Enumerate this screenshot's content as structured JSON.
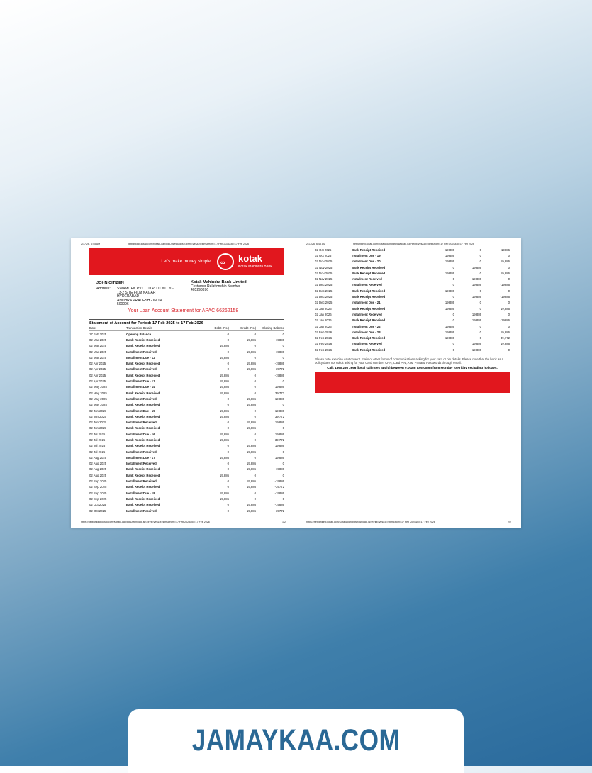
{
  "header": {
    "date": "2/17/26, 6:45 AM",
    "url": "netbanking.kotak.com/KotakLoan/pdfDownload.jsp?print=yes&ct=stmt&from=17 Feb 2025&to=17 Feb 2026"
  },
  "footer": {
    "url": "https://netbanking.kotak.com/KotakLoan/pdfDownload.jsp?print=yes&ct=stmt&from=17 Feb 2025&to=17 Feb 2026",
    "page1": "1/2",
    "page2": "2/2"
  },
  "banner": {
    "tagline": "Let's make money simple",
    "brand": "kotak",
    "brand_sub": "Kotak Mahindra Bank",
    "color": "#e1171e"
  },
  "customer": {
    "name": "JOHN CITIZEN",
    "address_label": "Address:",
    "address_lines": [
      "SWAMITEK PVT LTD PLOT NO 20-",
      "13-2 SITE FILM NAGAR",
      "HYDERABAD",
      "ANDHRA PRADESH - INDIA",
      "500096"
    ]
  },
  "bank": {
    "name": "Kotak Mahindra Bank Limited",
    "crn_label": "Customer Relationship Number",
    "crn": "405298896"
  },
  "statement": {
    "title": "Your Loan Account Statement for APAC 66262158",
    "period_label": "Statement of Account for Period:",
    "period": "17 Feb 2025 to 17 Feb 2026"
  },
  "columns": [
    "Date",
    "Transaction Details",
    "Debit (Rs.)",
    "Credit (Rs.)",
    "Closing Balance"
  ],
  "page1_rows": [
    [
      "17 Feb 2025",
      "Opening Balance",
      "0",
      "0",
      "0"
    ],
    [
      "02 Mar 2025",
      "Bank Receipt Received",
      "0",
      "19,886",
      "-19886"
    ],
    [
      "02 Mar 2025",
      "Bank Receipt Received",
      "19,886",
      "0",
      "0"
    ],
    [
      "02 Mar 2025",
      "Installment Received",
      "0",
      "19,886",
      "-19886"
    ],
    [
      "02 Mar 2025",
      "Installment Due - 12",
      "19,886",
      "0",
      "0"
    ],
    [
      "02 Apr 2025",
      "Bank Receipt Received",
      "0",
      "19,886",
      "-19886"
    ],
    [
      "02 Apr 2025",
      "Installment Received",
      "0",
      "19,886",
      "-39772"
    ],
    [
      "02 Apr 2025",
      "Bank Receipt Received",
      "19,886",
      "0",
      "-19886"
    ],
    [
      "02 Apr 2025",
      "Installment Due - 13",
      "19,886",
      "0",
      "0"
    ],
    [
      "02 May 2025",
      "Installment Due - 14",
      "19,886",
      "0",
      "19,886"
    ],
    [
      "02 May 2025",
      "Bank Receipt Received",
      "19,886",
      "0",
      "39,772"
    ],
    [
      "02 May 2025",
      "Installment Received",
      "0",
      "19,886",
      "19,886"
    ],
    [
      "02 May 2025",
      "Bank Receipt Received",
      "0",
      "19,886",
      "0"
    ],
    [
      "02 Jun 2025",
      "Installment Due - 15",
      "19,886",
      "0",
      "19,886"
    ],
    [
      "02 Jun 2025",
      "Bank Receipt Received",
      "19,886",
      "0",
      "39,772"
    ],
    [
      "02 Jun 2025",
      "Installment Received",
      "0",
      "19,886",
      "19,886"
    ],
    [
      "02 Jun 2025",
      "Bank Receipt Received",
      "0",
      "19,886",
      "0"
    ],
    [
      "02 Jul 2025",
      "Installment Due - 16",
      "19,886",
      "0",
      "19,886"
    ],
    [
      "02 Jul 2025",
      "Bank Receipt Received",
      "19,886",
      "0",
      "39,772"
    ],
    [
      "02 Jul 2025",
      "Bank Receipt Received",
      "0",
      "19,886",
      "19,886"
    ],
    [
      "02 Jul 2025",
      "Installment Received",
      "0",
      "19,886",
      "0"
    ],
    [
      "02 Aug 2025",
      "Installment Due - 17",
      "19,886",
      "0",
      "19,886"
    ],
    [
      "02 Aug 2025",
      "Installment Received",
      "0",
      "19,886",
      "0"
    ],
    [
      "02 Aug 2025",
      "Bank Receipt Received",
      "0",
      "19,886",
      "-19886"
    ],
    [
      "02 Aug 2025",
      "Bank Receipt Received",
      "19,886",
      "0",
      "0"
    ],
    [
      "02 Sep 2025",
      "Installment Received",
      "0",
      "19,886",
      "-19886"
    ],
    [
      "02 Sep 2025",
      "Bank Receipt Received",
      "0",
      "19,886",
      "-39772"
    ],
    [
      "02 Sep 2025",
      "Installment Due - 18",
      "19,886",
      "0",
      "-19886"
    ],
    [
      "02 Sep 2025",
      "Bank Receipt Received",
      "19,886",
      "0",
      "0"
    ],
    [
      "02 Oct 2025",
      "Bank Receipt Received",
      "0",
      "19,886",
      "-19886"
    ],
    [
      "02 Oct 2025",
      "Installment Received",
      "0",
      "19,886",
      "-39772"
    ]
  ],
  "page2_rows": [
    [
      "02 Oct 2025",
      "Bank Receipt Received",
      "19,886",
      "0",
      "-19886"
    ],
    [
      "02 Oct 2025",
      "Installment Due - 19",
      "19,886",
      "0",
      "0"
    ],
    [
      "02 Nov 2025",
      "Installment Due - 20",
      "19,886",
      "0",
      "19,886"
    ],
    [
      "02 Nov 2025",
      "Bank Receipt Received",
      "0",
      "19,886",
      "0"
    ],
    [
      "02 Nov 2025",
      "Bank Receipt Received",
      "19,886",
      "0",
      "19,886"
    ],
    [
      "02 Nov 2025",
      "Installment Received",
      "0",
      "19,886",
      "0"
    ],
    [
      "02 Dec 2025",
      "Installment Received",
      "0",
      "19,886",
      "-19886"
    ],
    [
      "02 Dec 2025",
      "Bank Receipt Received",
      "19,886",
      "0",
      "0"
    ],
    [
      "02 Dec 2025",
      "Bank Receipt Received",
      "0",
      "19,886",
      "-19886"
    ],
    [
      "02 Dec 2025",
      "Installment Due - 21",
      "19,886",
      "0",
      "0"
    ],
    [
      "02 Jan 2026",
      "Bank Receipt Received",
      "19,886",
      "0",
      "19,886"
    ],
    [
      "02 Jan 2026",
      "Installment Received",
      "0",
      "19,886",
      "0"
    ],
    [
      "02 Jan 2026",
      "Bank Receipt Received",
      "0",
      "19,886",
      "-19886"
    ],
    [
      "02 Jan 2026",
      "Installment Due - 22",
      "19,886",
      "0",
      "0"
    ],
    [
      "02 Feb 2026",
      "Installment Due - 23",
      "19,886",
      "0",
      "19,886"
    ],
    [
      "02 Feb 2026",
      "Bank Receipt Received",
      "19,886",
      "0",
      "39,772"
    ],
    [
      "02 Feb 2026",
      "Installment Received",
      "0",
      "19,886",
      "19,886"
    ],
    [
      "02 Feb 2026",
      "Bank Receipt Received",
      "0",
      "19,886",
      "0"
    ]
  ],
  "notice": "Please note exercise caution w.r.t. mails or other forms of communications asking for your card or pin details. Please note that the bank as a policy does not solicit asking for your Card Number, CRN, Card PIN, ATM PIN and Passwords through email.",
  "call": "Call: 1860 266 2666 (local call rates apply) between 9:00am to 6:00pm from Monday to Friday excluding holidays.",
  "site": "JAMAYKAA.COM"
}
